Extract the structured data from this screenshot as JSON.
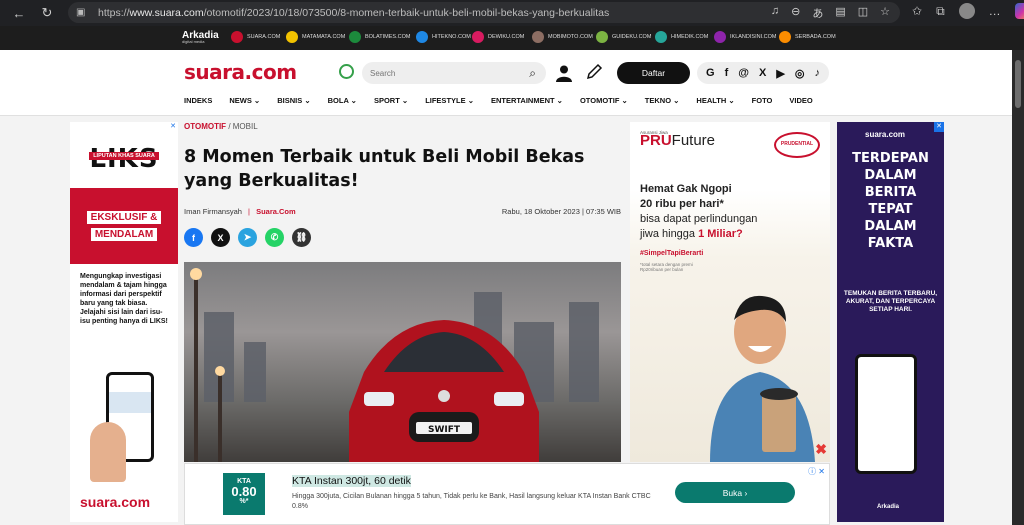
{
  "browser": {
    "url_prefix": "https://",
    "url_domain": "www.suara.com",
    "url_path": "/otomotif/2023/10/18/073500/8-momen-terbaik-untuk-beli-mobil-bekas-yang-berkualitas"
  },
  "network": {
    "logo": "Arkadia",
    "logo_sub": "digital media",
    "sites": [
      {
        "label": "SUARA.COM",
        "color": "#c8102e"
      },
      {
        "label": "MATAMATA.COM",
        "color": "#f2c200"
      },
      {
        "label": "BOLATIMES.COM",
        "color": "#1c8a3c"
      },
      {
        "label": "HITEKNO.COM",
        "color": "#1e88e5"
      },
      {
        "label": "DEWIKU.COM",
        "color": "#d81b60"
      },
      {
        "label": "MOBIMOTO.COM",
        "color": "#8d6e63"
      },
      {
        "label": "GUIDEKU.COM",
        "color": "#7cb342"
      },
      {
        "label": "HIMEDIK.COM",
        "color": "#26a69a"
      },
      {
        "label": "IKLANDISINI.COM",
        "color": "#8e24aa"
      },
      {
        "label": "SERBADA.COM",
        "color": "#fb8c00"
      }
    ]
  },
  "header": {
    "logo": "suara.com",
    "search_placeholder": "Search",
    "register_label": "Daftar",
    "socials": [
      "G",
      "f",
      "@",
      "X",
      "▶",
      "◎",
      "♪"
    ]
  },
  "menu": [
    "INDEKS",
    "NEWS",
    "BISNIS",
    "BOLA",
    "SPORT",
    "LIFESTYLE",
    "ENTERTAINMENT",
    "OTOMOTIF",
    "TEKNO",
    "HEALTH",
    "FOTO",
    "VIDEO"
  ],
  "menu_dropdown": [
    false,
    true,
    true,
    true,
    true,
    true,
    true,
    true,
    true,
    true,
    false,
    false
  ],
  "article": {
    "category": "OTOMOTIF",
    "subcategory": "/ MOBIL",
    "title": "8 Momen Terbaik untuk Beli Mobil Bekas yang Berkualitas!",
    "author": "Iman Firmansyah",
    "separator": "|",
    "source": "Suara.Com",
    "date": "Rabu, 18 Oktober 2023 | 07:35 WIB",
    "car_badge": "SWIFT"
  },
  "share": [
    {
      "name": "facebook",
      "glyph": "f",
      "color": "#1877f2"
    },
    {
      "name": "x",
      "glyph": "X",
      "color": "#111111"
    },
    {
      "name": "telegram",
      "glyph": "➤",
      "color": "#2aa3df"
    },
    {
      "name": "whatsapp",
      "glyph": "✆",
      "color": "#25d366"
    },
    {
      "name": "copy-link",
      "glyph": "⛓",
      "color": "#333333"
    }
  ],
  "ad_left": {
    "logo": "LIKS",
    "logo_sub": "LIPUTAN KHAS SUARA",
    "label1": "EKSKLUSIF &",
    "label2": "MENDALAM",
    "text": "Mengungkap investigasi mendalam & tajam hingga informasi dari perspektif baru yang tak biasa. Jelajahi sisi lain dari isu-isu penting hanya di LIKS!",
    "footer": "suara.com"
  },
  "ad_pru": {
    "pre": "Asuransi Jiwa",
    "logo_a": "PRU",
    "logo_b": "Future",
    "brand": "PRUDENTIAL",
    "line1": "Hemat Gak Ngopi",
    "line2": "20 ribu per hari*",
    "line3": "bisa dapat perlindungan",
    "line4a": "jiwa hingga ",
    "line4b": "1 Miliar?",
    "tag": "#SimpelTapiBerarti",
    "note": "*total setara dengan premi Rp20ribuan per bulan"
  },
  "ad_suara": {
    "brand": "suara.com",
    "lines": [
      "TERDEPAN",
      "DALAM",
      "BERITA",
      "TEPAT",
      "DALAM",
      "FAKTA"
    ],
    "small": "TEMUKAN BERITA TERBARU, AKURAT, DAN TERPERCAYA SETIAP HARI.",
    "footer": "Arkadia"
  },
  "bottom_ad": {
    "logo_top": "KTA",
    "logo_rate": "0.80",
    "logo_pct": "%*",
    "title": "KTA Instan 300jt, 60 detik",
    "desc": "Hingga 300juta, Cicilan Bulanan hingga 5 tahun, Tidak perlu ke Bank, Hasil langsung keluar KTA Instan Bank CTBC 0.8%",
    "cta": "Buka"
  }
}
